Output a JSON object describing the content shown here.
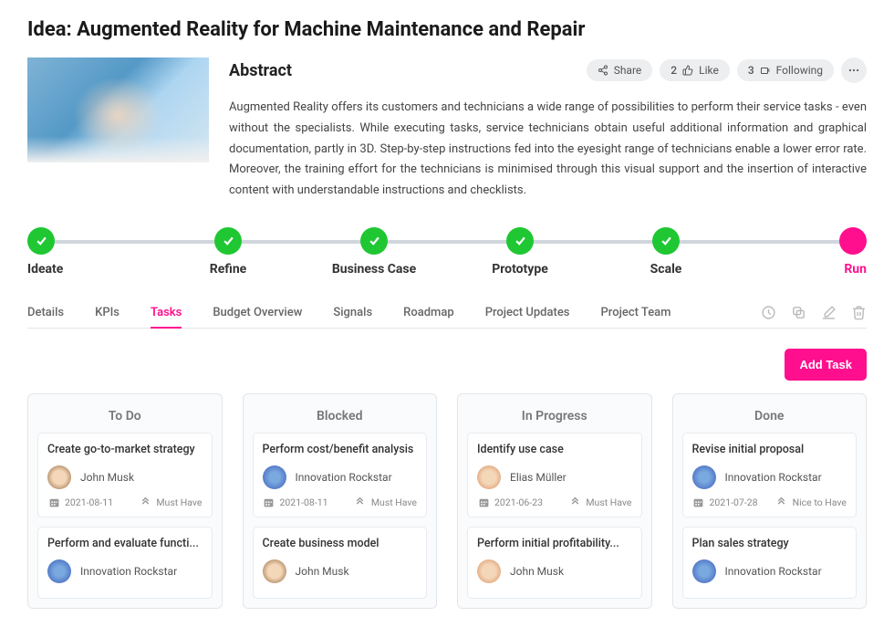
{
  "page_title": "Idea: Augmented Reality for Machine Maintenance and Repair",
  "abstract": {
    "heading": "Abstract",
    "text": "Augmented Reality offers its customers and technicians a wide range of possibilities to perform their service tasks - even without the specialists. While executing tasks, service technicians obtain useful additional information and graphical documentation, partly in 3D. Step-by-step instructions fed into the eyesight range of technicians enable a lower error rate. Moreover, the training effort for the technicians is minimised through this visual support and the insertion of interactive content with understandable instructions and checklists."
  },
  "header_actions": {
    "share": "Share",
    "like_count": "2",
    "like_label": "Like",
    "follow_count": "3",
    "follow_label": "Following"
  },
  "stages": [
    {
      "label": "Ideate",
      "state": "done"
    },
    {
      "label": "Refine",
      "state": "done"
    },
    {
      "label": "Business Case",
      "state": "done"
    },
    {
      "label": "Prototype",
      "state": "done"
    },
    {
      "label": "Scale",
      "state": "done"
    },
    {
      "label": "Run",
      "state": "active"
    }
  ],
  "tabs": [
    "Details",
    "KPIs",
    "Tasks",
    "Budget Overview",
    "Signals",
    "Roadmap",
    "Project Updates",
    "Project Team"
  ],
  "active_tab": "Tasks",
  "add_task_label": "Add Task",
  "columns": [
    {
      "title": "To Do",
      "cards": [
        {
          "title": "Create go-to-market strategy",
          "user": "John Musk",
          "avatar": "a1",
          "date": "2021-08-11",
          "priority": "Must Have"
        },
        {
          "title": "Perform and evaluate functi...",
          "user": "Innovation Rockstar",
          "avatar": "a2"
        }
      ]
    },
    {
      "title": "Blocked",
      "cards": [
        {
          "title": "Perform cost/benefit analysis",
          "user": "Innovation Rockstar",
          "avatar": "a2",
          "date": "2021-08-11",
          "priority": "Must Have"
        },
        {
          "title": "Create business model",
          "user": "John Musk",
          "avatar": "a1"
        }
      ]
    },
    {
      "title": "In Progress",
      "cards": [
        {
          "title": "Identify use case",
          "user": "Elias Müller",
          "avatar": "a3",
          "date": "2021-06-23",
          "priority": "Must Have"
        },
        {
          "title": "Perform initial profitability...",
          "user": "John Musk",
          "avatar": "a3"
        }
      ]
    },
    {
      "title": "Done",
      "cards": [
        {
          "title": "Revise initial proposal",
          "user": "Innovation Rockstar",
          "avatar": "a2",
          "date": "2021-07-28",
          "priority": "Nice to Have"
        },
        {
          "title": "Plan sales strategy",
          "user": "Innovation Rockstar",
          "avatar": "a2"
        }
      ]
    }
  ]
}
